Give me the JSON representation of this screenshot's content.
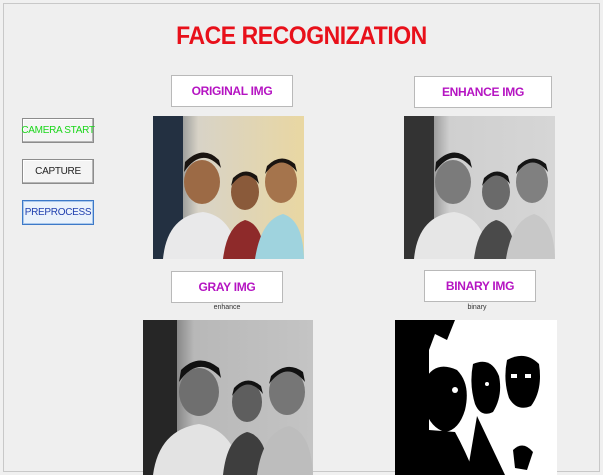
{
  "window": {
    "title": "FACE RECOGNIZATION"
  },
  "buttons": {
    "camera_start": "CAMERA START",
    "capture": "CAPTURE",
    "preprocess": "PREPROCESS"
  },
  "panels": {
    "original": {
      "label": "ORIGINAL IMG",
      "axis_title": ""
    },
    "enhance": {
      "label": "ENHANCE  IMG",
      "axis_title": ""
    },
    "gray": {
      "label": "GRAY IMG",
      "axis_title": "enhance"
    },
    "binary": {
      "label": "BINARY IMG",
      "axis_title": "binary"
    }
  },
  "colors": {
    "title": "#e8101a",
    "panel_label": "#b514c2",
    "camera_start": "#19d619",
    "preprocess": "#1f3fae"
  }
}
